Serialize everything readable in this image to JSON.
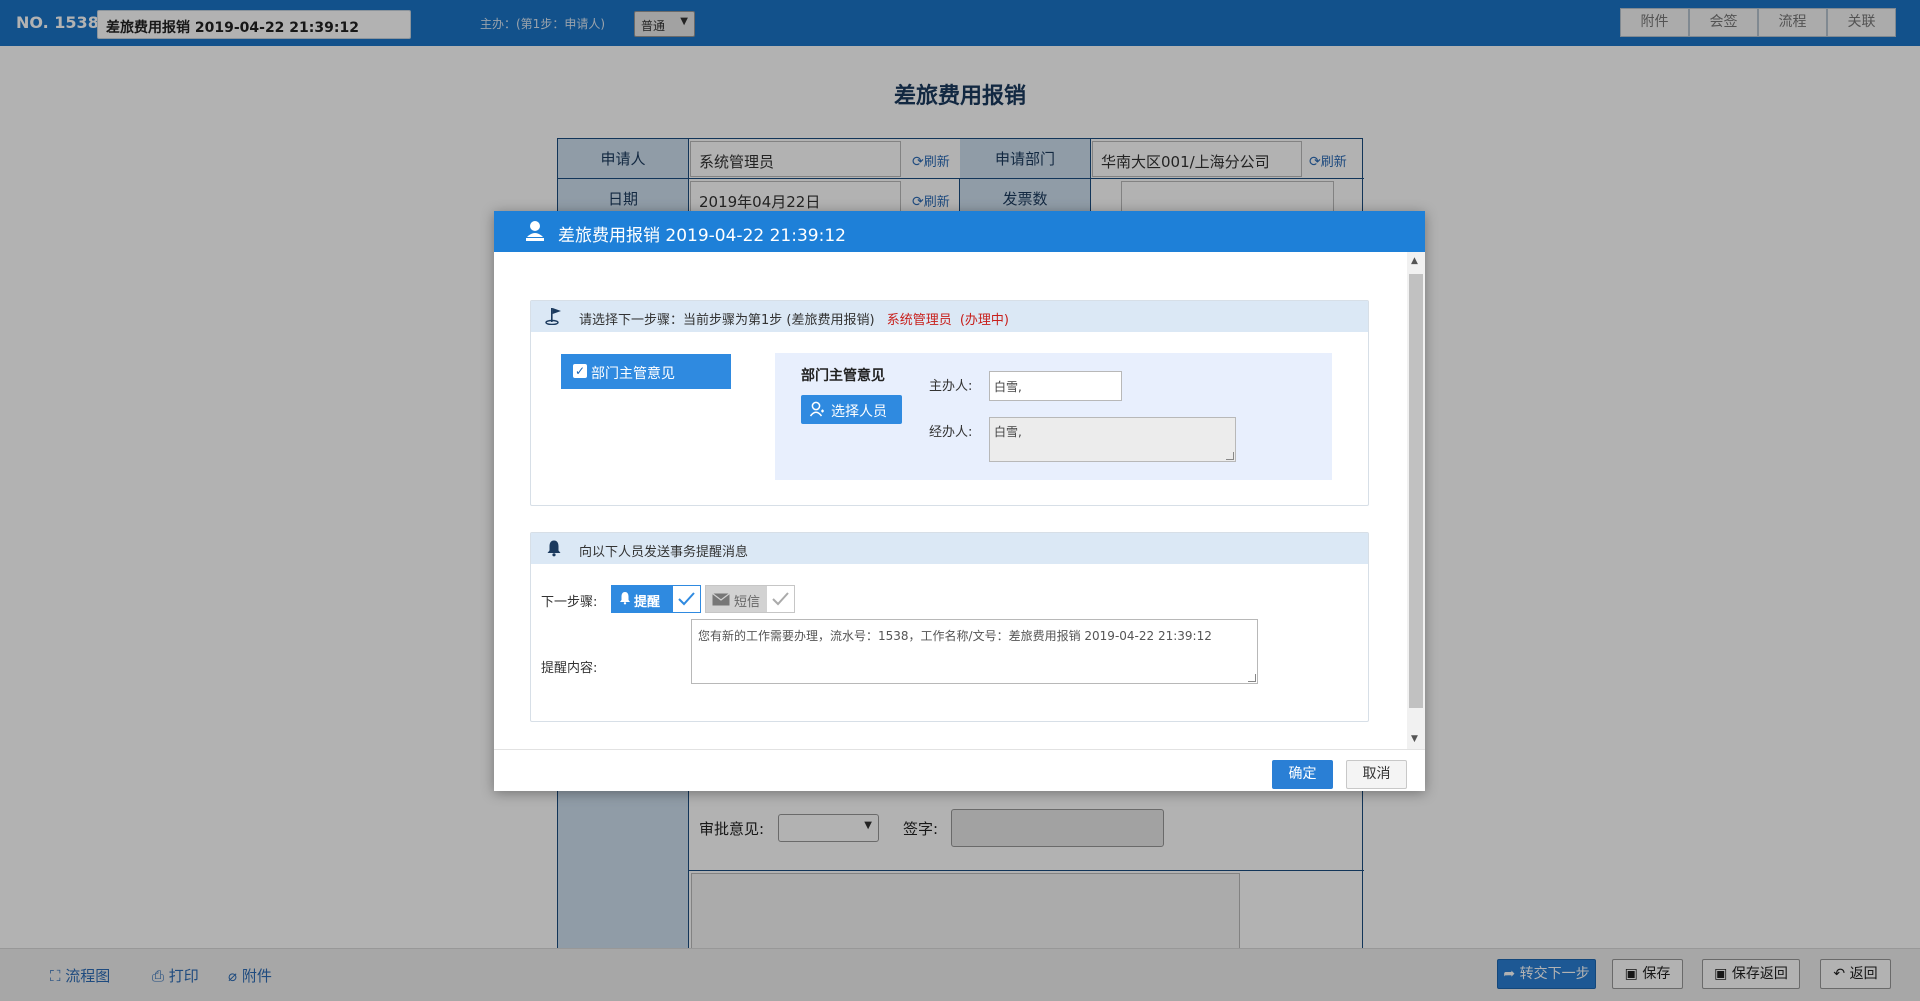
{
  "topbar": {
    "number": "NO. 1538",
    "title_value": "差旅费用报销 2019-04-22 21:39:12",
    "host_text": "主办：(第1步：申请人)",
    "level_value": "普通",
    "buttons": [
      "附件",
      "会签",
      "流程",
      "关联"
    ]
  },
  "form": {
    "title": "差旅费用报销",
    "applicant_label": "申请人",
    "applicant_value": "系统管理员",
    "refresh_label": "刷新",
    "dept_label": "申请部门",
    "dept_value": "华南大区001/上海分公司",
    "date_label": "日期",
    "date_value": "2019年04月22日",
    "invoice_label": "发票数",
    "approval_label": "审批意见:",
    "sign_label": "签字:"
  },
  "bottombar": {
    "flowchart": "流程图",
    "print": "打印",
    "attachment": "附件",
    "next_step": "转交下一步",
    "save": "保存",
    "save_return": "保存返回",
    "return": "返回"
  },
  "modal": {
    "title": "差旅费用报销 2019-04-22 21:39:12",
    "step_panel": {
      "header_prefix": "请选择下一步骤：当前步骤为第1步 (差旅费用报销)",
      "header_user": "系统管理员",
      "header_status": "(办理中)",
      "step_item": "部门主管意见",
      "detail_title": "部门主管意见",
      "pick_button": "选择人员",
      "host_label": "主办人:",
      "host_value": "白雪,",
      "handler_label": "经办人:",
      "handler_value": "白雪,"
    },
    "remind_panel": {
      "header": "向以下人员发送事务提醒消息",
      "next_step_label": "下一步骤:",
      "remind_label": "提醒",
      "sms_label": "短信",
      "content_label": "提醒内容:",
      "content_value": "您有新的工作需要办理，流水号：1538，工作名称/文号：差旅费用报销 2019-04-22 21:39:12"
    },
    "ok": "确定",
    "cancel": "取消"
  },
  "colors": {
    "primary": "#1e80d8",
    "header_bg": "#1a74c8",
    "status_red": "#c8201c",
    "table_head": "#cfe0f0"
  }
}
